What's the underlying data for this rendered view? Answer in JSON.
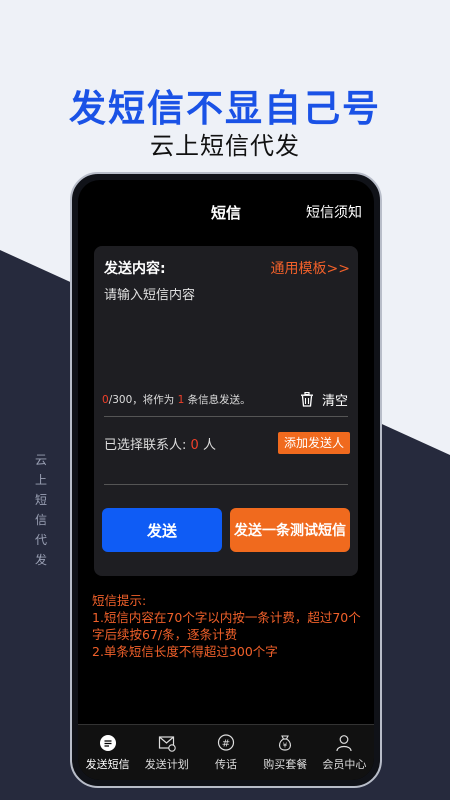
{
  "hero": {
    "title": "发短信不显自己号",
    "subtitle": "云上短信代发"
  },
  "side_text": [
    "云",
    "上",
    "短",
    "信",
    "代",
    "发"
  ],
  "topbar": {
    "title": "短信",
    "notice": "短信须知"
  },
  "compose": {
    "label": "发送内容:",
    "template_link": "通用模板>>",
    "placeholder": "请输入短信内容",
    "char_count": "0",
    "char_max": "/300，将作为",
    "msg_count": "1",
    "msg_suffix": "条信息发送。",
    "clear_label": "清空",
    "contacts_prefix": "已选择联系人:",
    "contacts_count": "0",
    "contacts_unit": "人",
    "add_contact": "添加发送人",
    "send_label": "发送",
    "test_label": "发送一条测试短信"
  },
  "tips": {
    "heading": "短信提示:",
    "line1": "1.短信内容在70个字以内按一条计费，超过70个字后续按67/条，逐条计费",
    "line2": "2.单条短信长度不得超过300个字"
  },
  "tabs": [
    {
      "label": "发送短信",
      "icon": "message-icon",
      "active": true
    },
    {
      "label": "发送计划",
      "icon": "mail-clock-icon",
      "active": false
    },
    {
      "label": "传话",
      "icon": "hash-bubble-icon",
      "active": false
    },
    {
      "label": "购买套餐",
      "icon": "yen-bag-icon",
      "active": false
    },
    {
      "label": "会员中心",
      "icon": "user-icon",
      "active": false
    }
  ],
  "colors": {
    "accent_blue": "#0f5cf5",
    "accent_orange": "#f06a1e",
    "hero_blue": "#1a52e6"
  }
}
